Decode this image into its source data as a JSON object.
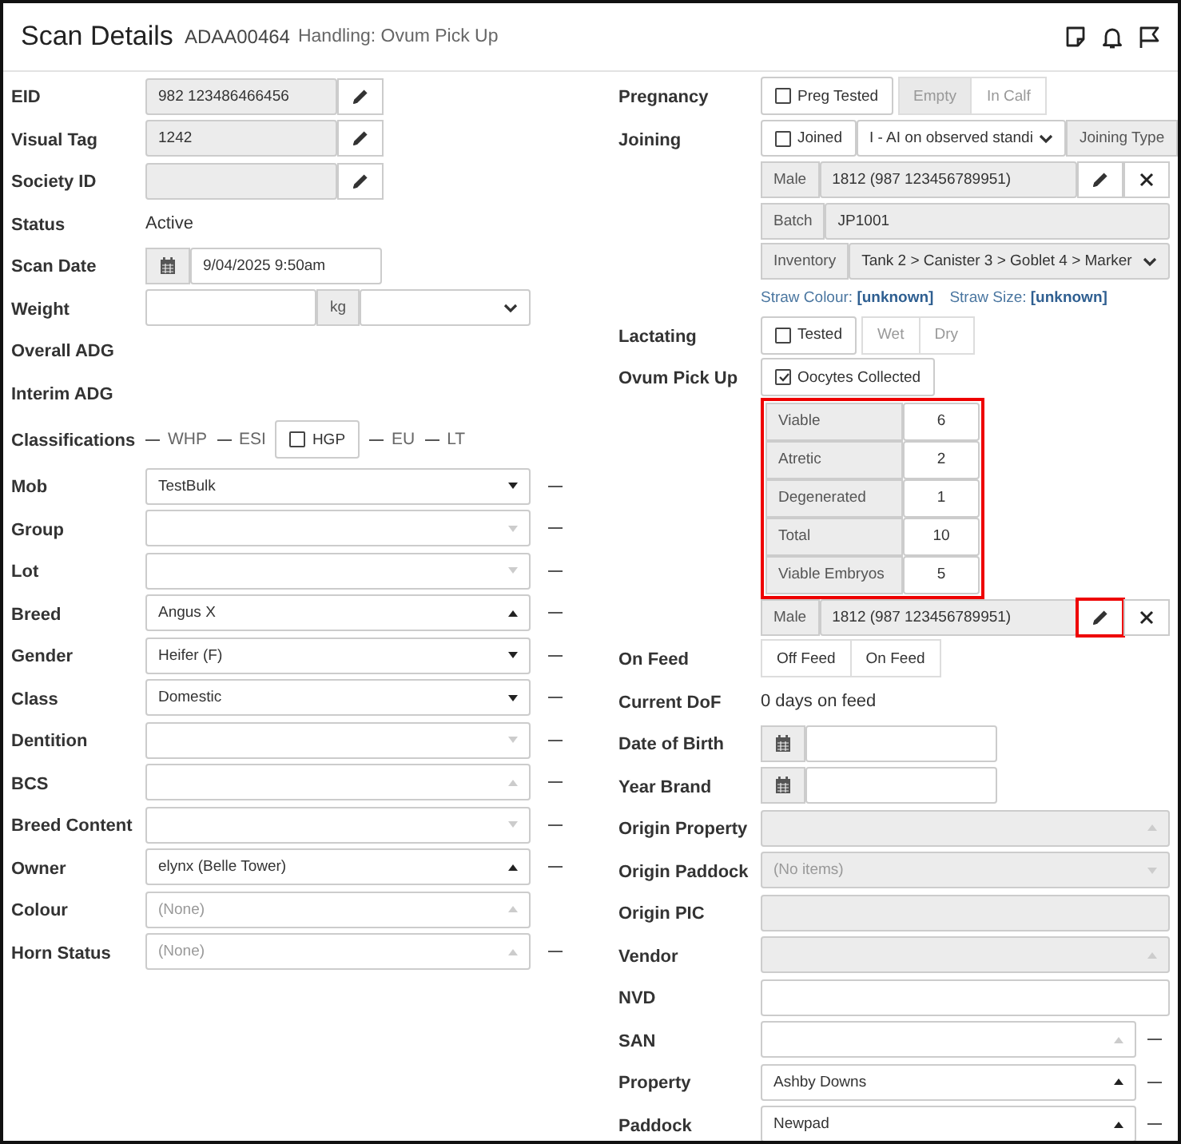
{
  "header": {
    "title": "Scan Details",
    "id": "ADAA00464",
    "subtitle": "Handling: Ovum Pick Up"
  },
  "left": [
    {
      "label": "EID",
      "kind": "compact",
      "parts": [
        {
          "kind": "input",
          "value": "982 123486466456",
          "disabled": true
        },
        {
          "kind": "edit",
          "highlight": false
        }
      ]
    },
    {
      "label": "Visual Tag",
      "kind": "compact",
      "parts": [
        {
          "kind": "input",
          "value": "1242",
          "disabled": true
        },
        {
          "kind": "edit",
          "highlight": false
        }
      ]
    },
    {
      "label": "Society ID",
      "kind": "compact",
      "parts": [
        {
          "kind": "input",
          "disabled": true
        },
        {
          "kind": "edit",
          "highlight": false
        }
      ]
    },
    {
      "label": "Status",
      "kind": "inline",
      "parts": [
        {
          "kind": "text",
          "value": "Active"
        }
      ]
    },
    {
      "label": "Scan Date",
      "kind": "compact",
      "parts": [
        {
          "kind": "date"
        },
        {
          "kind": "input",
          "value": "9/04/2025 9:50am",
          "disabled": false
        }
      ]
    },
    {
      "label": "Weight",
      "kind": "full",
      "parts": [
        {
          "kind": "input",
          "disabled": false
        },
        {
          "kind": "addon",
          "text": "kg"
        },
        {
          "kind": "menu",
          "disabled": false
        }
      ]
    },
    {
      "label": "Overall ADG",
      "kind": "inline"
    },
    {
      "label": "Interim ADG",
      "kind": "inline"
    },
    {
      "label": "Classifications",
      "kind": "tall",
      "parts": [
        {
          "kind": "dash",
          "text": "WHP"
        },
        {
          "kind": "dash",
          "text": "ESI"
        },
        {
          "kind": "check",
          "text": "HGP",
          "checked": false
        },
        {
          "kind": "dash",
          "text": "EU"
        },
        {
          "kind": "dash",
          "text": "LT"
        }
      ]
    },
    {
      "label": "Mob",
      "kind": "full",
      "removable": true,
      "parts": [
        {
          "kind": "select",
          "value": "TestBulk",
          "caret_up": false,
          "disabled": false
        }
      ]
    },
    {
      "label": "Group",
      "kind": "full",
      "removable": true,
      "parts": [
        {
          "kind": "select",
          "caret_up": false,
          "disabled": false
        }
      ]
    },
    {
      "label": "Lot",
      "kind": "full",
      "removable": true,
      "parts": [
        {
          "kind": "select",
          "caret_up": false,
          "disabled": false
        }
      ]
    },
    {
      "label": "Breed",
      "kind": "full",
      "removable": true,
      "parts": [
        {
          "kind": "select",
          "value": "Angus X",
          "caret_up": true,
          "disabled": false
        }
      ]
    },
    {
      "label": "Gender",
      "kind": "full",
      "removable": true,
      "parts": [
        {
          "kind": "select",
          "value": "Heifer (F)",
          "caret_up": false,
          "disabled": false
        }
      ]
    },
    {
      "label": "Class",
      "kind": "full",
      "removable": true,
      "parts": [
        {
          "kind": "select",
          "value": "Domestic",
          "caret_up": false,
          "disabled": false
        }
      ]
    },
    {
      "label": "Dentition",
      "kind": "full",
      "removable": true,
      "parts": [
        {
          "kind": "select",
          "caret_up": false,
          "disabled": false
        }
      ]
    },
    {
      "label": "BCS",
      "kind": "full",
      "removable": true,
      "parts": [
        {
          "kind": "select",
          "caret_up": true,
          "disabled": false
        }
      ]
    },
    {
      "label": "Breed Content",
      "kind": "full",
      "removable": true,
      "parts": [
        {
          "kind": "select",
          "caret_up": false,
          "disabled": false
        }
      ]
    },
    {
      "label": "Owner",
      "kind": "full",
      "removable": true,
      "parts": [
        {
          "kind": "select",
          "value": "elynx (Belle Tower)",
          "caret_up": true,
          "disabled": false
        }
      ]
    },
    {
      "label": "Colour",
      "kind": "full",
      "removable": false,
      "parts": [
        {
          "kind": "select",
          "placeholder": "(None)",
          "caret_up": true,
          "disabled": false
        }
      ]
    },
    {
      "label": "Horn Status",
      "kind": "full",
      "removable": true,
      "parts": [
        {
          "kind": "select",
          "placeholder": "(None)",
          "caret_up": true,
          "disabled": false
        }
      ]
    }
  ],
  "right": [
    {
      "label": "Pregnancy",
      "kind": "inline",
      "parts": [
        {
          "kind": "check",
          "text": "Preg Tested",
          "checked": false
        },
        {
          "kind": "option",
          "text": "Empty",
          "selected": true,
          "disabled": true
        },
        {
          "kind": "option",
          "text": "In Calf",
          "selected": false,
          "disabled": true
        }
      ]
    },
    {
      "label": "Joining",
      "kind": "full",
      "parts": [
        {
          "kind": "check",
          "text": "Joined",
          "checked": false
        },
        {
          "kind": "menu",
          "value": "I - AI on observed standi",
          "disabled": false
        },
        {
          "kind": "addon",
          "text": "Joining Type"
        }
      ]
    },
    {
      "kind": "full",
      "parts": [
        {
          "kind": "addon",
          "text": "Male"
        },
        {
          "kind": "input",
          "value": "1812 (987 123456789951)",
          "disabled": true
        },
        {
          "kind": "edit",
          "highlight": false
        },
        {
          "kind": "clear"
        }
      ]
    },
    {
      "kind": "full",
      "parts": [
        {
          "kind": "addon",
          "text": "Batch"
        },
        {
          "kind": "input",
          "value": "JP1001",
          "disabled": true
        }
      ]
    },
    {
      "kind": "full",
      "parts": [
        {
          "kind": "addon",
          "text": "Inventory"
        },
        {
          "kind": "menu",
          "value": "Tank 2 > Canister 3 > Goblet 4 > Marker",
          "disabled": true
        }
      ]
    },
    {
      "kind": "inline",
      "parts": [
        {
          "kind": "links",
          "items": [
            "Straw Colour: **[unknown]**",
            "Straw Size: **[unknown]**"
          ]
        }
      ]
    },
    {
      "label": "Lactating",
      "kind": "inline",
      "parts": [
        {
          "kind": "check",
          "text": "Tested",
          "checked": false
        },
        {
          "kind": "option",
          "text": "Wet",
          "selected": false,
          "disabled": true
        },
        {
          "kind": "option",
          "text": "Dry",
          "selected": false,
          "disabled": true
        }
      ]
    },
    {
      "label": "Ovum Pick Up",
      "kind": "inline",
      "parts": [
        {
          "kind": "check",
          "text": "Oocytes Collected",
          "checked": true
        }
      ]
    },
    {
      "kind": "inline",
      "parts": [
        {
          "kind": "counts",
          "highlight": true,
          "rows": [
            {
              "label": "Viable",
              "value": "6"
            },
            {
              "label": "Atretic",
              "value": "2"
            },
            {
              "label": "Degenerated",
              "value": "1"
            },
            {
              "label": "Total",
              "value": "10"
            },
            {
              "label": "Viable Embryos",
              "value": "5"
            }
          ]
        }
      ]
    },
    {
      "kind": "full",
      "parts": [
        {
          "kind": "addon",
          "text": "Male"
        },
        {
          "kind": "input",
          "value": "1812 (987 123456789951)",
          "disabled": true
        },
        {
          "kind": "edit",
          "highlight": true
        },
        {
          "kind": "clear"
        }
      ]
    },
    {
      "label": "On Feed",
      "kind": "inline",
      "parts": [
        {
          "kind": "option",
          "text": "Off Feed",
          "selected": false,
          "disabled": false
        },
        {
          "kind": "option",
          "text": "On Feed",
          "selected": false,
          "disabled": false
        }
      ]
    },
    {
      "label": "Current DoF",
      "kind": "inline",
      "parts": [
        {
          "kind": "text",
          "value": "0 days on feed"
        }
      ]
    },
    {
      "label": "Date of Birth",
      "kind": "compact",
      "parts": [
        {
          "kind": "date"
        },
        {
          "kind": "input",
          "disabled": false
        }
      ]
    },
    {
      "label": "Year Brand",
      "kind": "compact",
      "parts": [
        {
          "kind": "date"
        },
        {
          "kind": "input",
          "disabled": false
        }
      ]
    },
    {
      "label": "Origin Property",
      "kind": "full",
      "parts": [
        {
          "kind": "select",
          "caret_up": true,
          "disabled": true
        }
      ]
    },
    {
      "label": "Origin Paddock",
      "kind": "full",
      "parts": [
        {
          "kind": "select",
          "placeholder": "(No items)",
          "caret_up": false,
          "disabled": true
        }
      ]
    },
    {
      "label": "Origin PIC",
      "kind": "full",
      "parts": [
        {
          "kind": "input",
          "disabled": true
        }
      ]
    },
    {
      "label": "Vendor",
      "kind": "full",
      "parts": [
        {
          "kind": "select",
          "caret_up": true,
          "disabled": true
        }
      ]
    },
    {
      "label": "NVD",
      "kind": "full",
      "parts": [
        {
          "kind": "input",
          "disabled": false
        }
      ]
    },
    {
      "label": "SAN",
      "kind": "full",
      "removable": true,
      "parts": [
        {
          "kind": "select",
          "caret_up": true,
          "disabled": false
        }
      ]
    },
    {
      "label": "Property",
      "kind": "full",
      "removable": true,
      "parts": [
        {
          "kind": "select",
          "value": "Ashby Downs",
          "caret_up": true,
          "disabled": false
        }
      ]
    },
    {
      "label": "Paddock",
      "kind": "full",
      "removable": true,
      "parts": [
        {
          "kind": "select",
          "value": "Newpad",
          "caret_up": true,
          "disabled": false
        }
      ]
    }
  ]
}
